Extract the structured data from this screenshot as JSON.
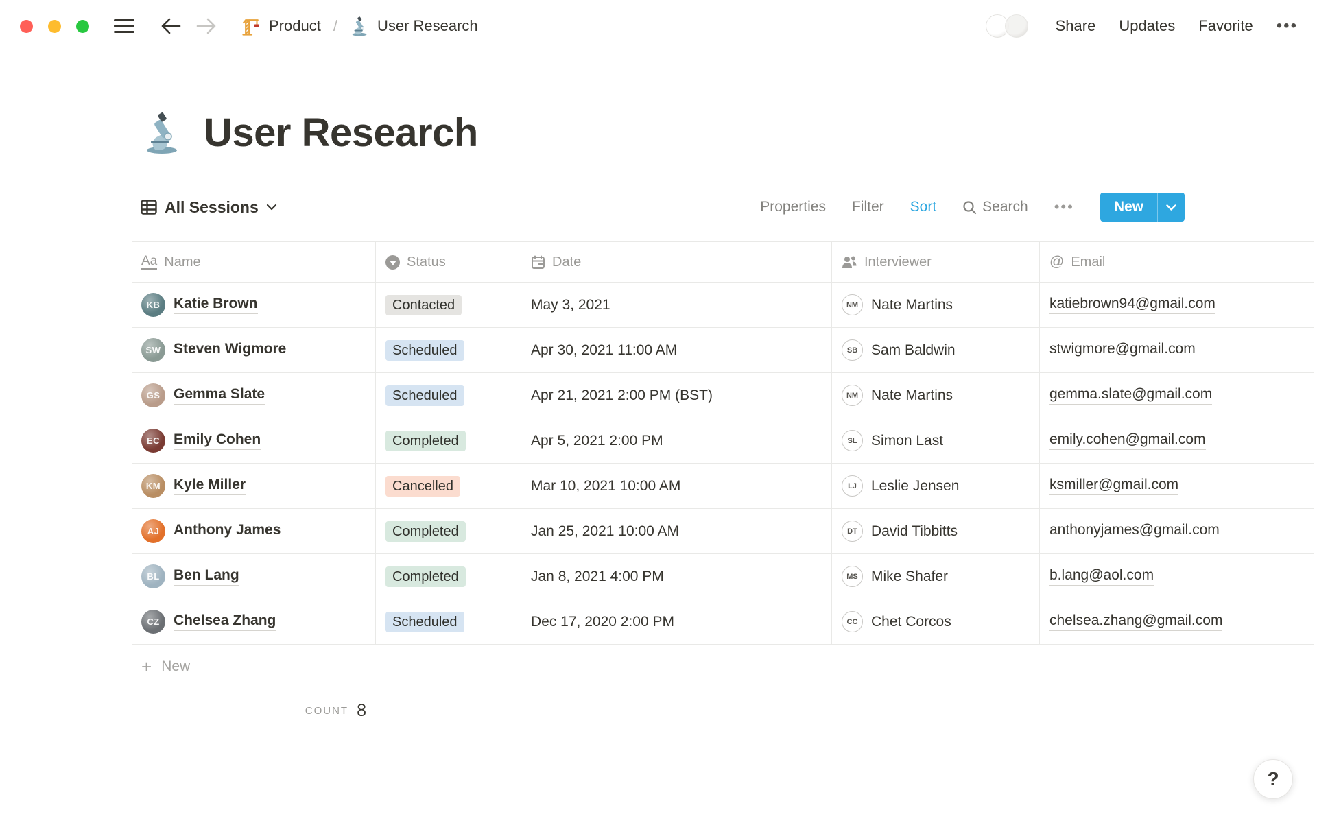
{
  "topbar": {
    "breadcrumb": {
      "parent": "Product",
      "separator": "/",
      "current": "User Research"
    },
    "share": "Share",
    "updates": "Updates",
    "favorite": "Favorite",
    "more": "•••"
  },
  "page": {
    "title": "User Research"
  },
  "toolbar": {
    "view_label": "All Sessions",
    "properties": "Properties",
    "filter": "Filter",
    "sort": "Sort",
    "search": "Search",
    "more": "•••",
    "new_label": "New"
  },
  "colors": {
    "accent": "#2EA7E0",
    "status": {
      "Contacted": "#E5E4E1",
      "Scheduled": "#D6E4F2",
      "Completed": "#D8E9DF",
      "Cancelled": "#FBDCCF"
    }
  },
  "table": {
    "columns": [
      {
        "icon": "text",
        "label": "Name"
      },
      {
        "icon": "select",
        "label": "Status"
      },
      {
        "icon": "calendar",
        "label": "Date"
      },
      {
        "icon": "person",
        "label": "Interviewer"
      },
      {
        "icon": "at",
        "label": "Email"
      }
    ],
    "rows": [
      {
        "name": "Katie Brown",
        "avatar_color": "#5B7D82",
        "status": "Contacted",
        "date": "May 3, 2021",
        "interviewer": "Nate Martins",
        "email": "katiebrown94@gmail.com"
      },
      {
        "name": "Steven Wigmore",
        "avatar_color": "#8A9A94",
        "status": "Scheduled",
        "date": "Apr 30, 2021 11:00 AM",
        "interviewer": "Sam Baldwin",
        "email": "stwigmore@gmail.com"
      },
      {
        "name": "Gemma Slate",
        "avatar_color": "#B99C8A",
        "status": "Scheduled",
        "date": "Apr 21, 2021 2:00 PM (BST)",
        "interviewer": "Nate Martins",
        "email": "gemma.slate@gmail.com"
      },
      {
        "name": "Emily Cohen",
        "avatar_color": "#7A3B33",
        "status": "Completed",
        "date": "Apr 5, 2021 2:00 PM",
        "interviewer": "Simon Last",
        "email": "emily.cohen@gmail.com"
      },
      {
        "name": "Kyle Miller",
        "avatar_color": "#B98E63",
        "status": "Cancelled",
        "date": "Mar 10, 2021 10:00 AM",
        "interviewer": "Leslie Jensen",
        "email": "ksmiller@gmail.com"
      },
      {
        "name": "Anthony James",
        "avatar_color": "#E2702A",
        "status": "Completed",
        "date": "Jan 25, 2021 10:00 AM",
        "interviewer": "David Tibbitts",
        "email": "anthonyjames@gmail.com"
      },
      {
        "name": "Ben Lang",
        "avatar_color": "#9FB3C0",
        "status": "Completed",
        "date": "Jan 8, 2021 4:00 PM",
        "interviewer": "Mike Shafer",
        "email": "b.lang@aol.com"
      },
      {
        "name": "Chelsea Zhang",
        "avatar_color": "#6B6F73",
        "status": "Scheduled",
        "date": "Dec 17, 2020 2:00 PM",
        "interviewer": "Chet Corcos",
        "email": "chelsea.zhang@gmail.com"
      }
    ],
    "new_row": "New",
    "count_label": "COUNT",
    "count_value": "8"
  },
  "help": "?"
}
